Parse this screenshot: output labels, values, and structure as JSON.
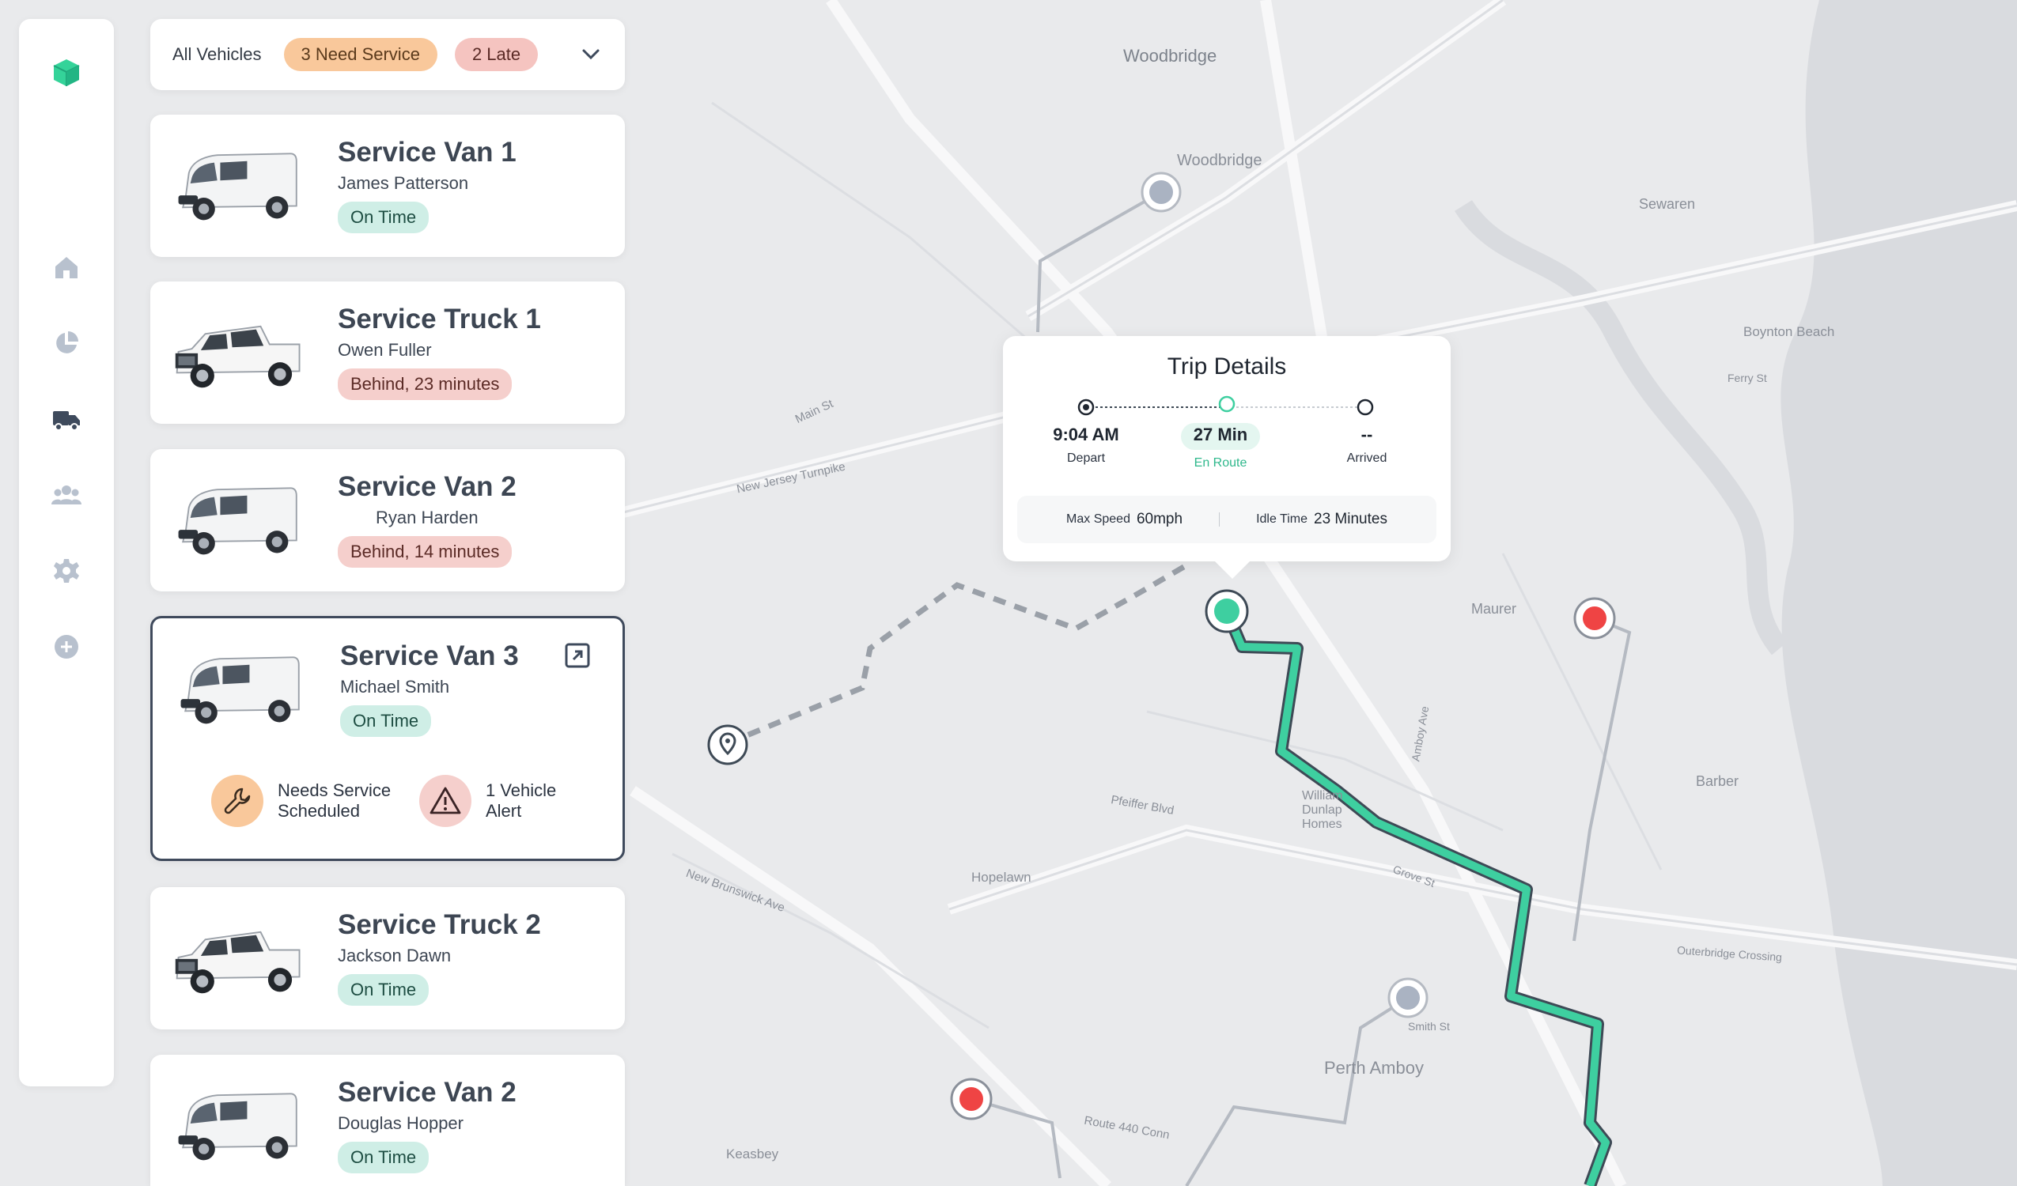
{
  "filters": {
    "all_label": "All Vehicles",
    "need_service_label": "3 Need Service",
    "late_label": "2 Late"
  },
  "nav": {
    "items": [
      "logo-icon",
      "home-icon",
      "chart-pie-icon",
      "truck-icon",
      "users-icon",
      "gear-icon",
      "plus-circle-icon"
    ]
  },
  "vehicles": [
    {
      "name": "Service Van 1",
      "driver": "James Patterson",
      "status": "On Time",
      "type": "van"
    },
    {
      "name": "Service Truck 1",
      "driver": "Owen Fuller",
      "status": "Behind, 23 minutes",
      "type": "truck"
    },
    {
      "name": "Service Van 2",
      "driver": "Ryan Harden",
      "status": "Behind, 14 minutes",
      "type": "van"
    },
    {
      "name": "Service Van 3",
      "driver": "Michael Smith",
      "status": "On Time",
      "type": "van",
      "alerts": [
        {
          "icon": "wrench-icon",
          "text_line1": "Needs Service",
          "text_line2": "Scheduled"
        },
        {
          "icon": "warning-icon",
          "text_line1": "1 Vehicle",
          "text_line2": "Alert"
        }
      ]
    },
    {
      "name": "Service Truck 2",
      "driver": "Jackson Dawn",
      "status": "On Time",
      "type": "truck"
    },
    {
      "name": "Service Van 2",
      "driver": "Douglas Hopper",
      "status": "On Time",
      "type": "van"
    }
  ],
  "trip": {
    "title": "Trip Details",
    "depart_value": "9:04 AM",
    "depart_label": "Depart",
    "enroute_value": "27 Min",
    "enroute_label": "En Route",
    "arrived_value": "--",
    "arrived_label": "Arrived",
    "max_speed_label": "Max Speed",
    "max_speed_value": "60mph",
    "idle_label": "Idle Time",
    "idle_value": "23 Minutes"
  },
  "map": {
    "labels": [
      "Woodbridge",
      "Woodbridge",
      "Sewaren",
      "Boynton Beach",
      "Maurer",
      "Barber",
      "Hopelawn",
      "Perth Amboy",
      "Keasbey",
      "New Jersey Turnpike",
      "Main St",
      "Pfeiffer Blvd",
      "New Brunswick Ave",
      "Route 440 Conn",
      "Ferry St",
      "Grove St",
      "Amboy Ave",
      "Smith St",
      "Outerbridge Crossing",
      "William Dunlap Homes"
    ]
  },
  "colors": {
    "route": "#3ecfa0",
    "on_time_bg": "#cfeee6",
    "late_bg": "#f5cfcc",
    "need_service_bg": "#f9c89b",
    "alert_red": "#ef4444",
    "logo_green": "#34d399"
  }
}
